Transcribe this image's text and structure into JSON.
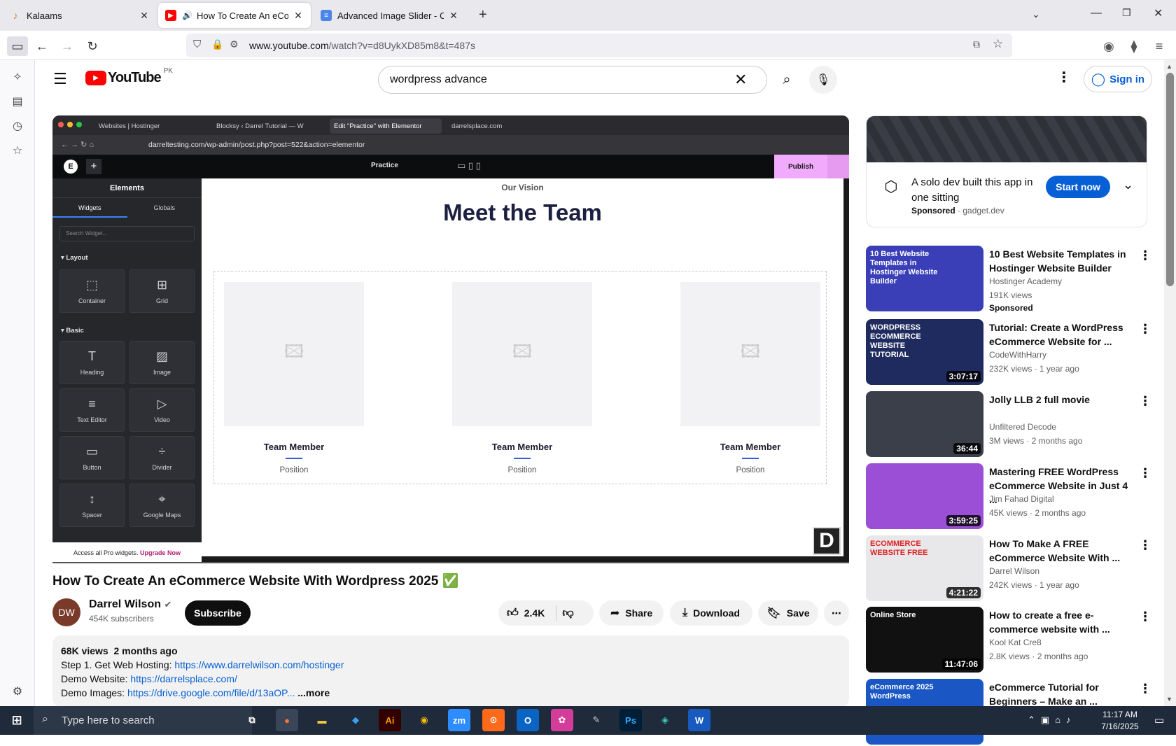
{
  "browser": {
    "tabs": [
      {
        "title": "Kalaams",
        "active": false
      },
      {
        "title": "How To Create An eComme",
        "active": true
      },
      {
        "title": "Advanced Image Slider - Code ·",
        "active": false
      }
    ],
    "new_tab": "+",
    "url_domain": "www.youtube.com",
    "url_path": "/watch?v=d8UykXD85m8&t=487s"
  },
  "youtube": {
    "logo_text": "YouTube",
    "region": "PK",
    "search_value": "wordpress advance",
    "signin_label": "Sign in"
  },
  "video_frame": {
    "inner_tabs": [
      "Websites | Hostinger",
      "Blocksy ‹ Darrel Tutorial — W",
      "Edit \"Practice\" with Elementor",
      "darrelsplace.com"
    ],
    "inner_url": "darreltesting.com/wp-admin/post.php?post=522&action=elementor",
    "page_name": "Practice",
    "publish_label": "Publish",
    "panel_title": "Elements",
    "panel_tabs": [
      "Widgets",
      "Globals"
    ],
    "search_placeholder": "Search Widget...",
    "section_layout": "Layout",
    "section_basic": "Basic",
    "widgets": [
      "Container",
      "Grid",
      "Heading",
      "Image",
      "Text Editor",
      "Video",
      "Button",
      "Divider",
      "Spacer",
      "Google Maps"
    ],
    "pro_note": "Access all Pro widgets.",
    "upgrade": "Upgrade Now",
    "vision": "Our Vision",
    "heading": "Meet the Team",
    "members": [
      {
        "name": "Team Member",
        "position": "Position"
      },
      {
        "name": "Team Member",
        "position": "Position"
      },
      {
        "name": "Team Member",
        "position": "Position"
      }
    ],
    "watermark": "D"
  },
  "video": {
    "title": "How To Create An eCommerce Website With Wordpress 2025 ✅",
    "channel": "Darrel Wilson",
    "subscribers": "454K subscribers",
    "subscribe_label": "Subscribe",
    "likes": "2.4K",
    "share_label": "Share",
    "download_label": "Download",
    "save_label": "Save",
    "views": "68K views",
    "age": "2 months ago",
    "desc_lines": [
      {
        "label": "Step 1. Get Web Hosting: ",
        "link": "https://www.darrelwilson.com/hostinger"
      },
      {
        "label": "Demo Website: ",
        "link": "https://darrelsplace.com/"
      },
      {
        "label": "Demo Images: ",
        "link": "https://drive.google.com/file/d/13aOP..."
      }
    ],
    "more_label": "...more"
  },
  "ad": {
    "title": "A solo dev built this app in one sitting",
    "sponsored": "Sponsored",
    "domain": "gadget.dev",
    "cta": "Start now"
  },
  "recommendations": [
    {
      "title": "10 Best Website Templates in Hostinger Website Builder",
      "channel": "Hostinger Academy",
      "meta": "191K views",
      "extra": "Sponsored",
      "duration": "",
      "thumb": "#3a3fb8",
      "thumb_text": "10 Best Website Templates in Hostinger Website Builder"
    },
    {
      "title": "Tutorial: Create a WordPress eCommerce Website for ...",
      "channel": "CodeWithHarry",
      "meta": "232K views · 1 year ago",
      "extra": "",
      "duration": "3:07:17",
      "thumb": "#1f2b5e",
      "thumb_text": "WORDPRESS ECOMMERCE WEBSITE TUTORIAL"
    },
    {
      "title": "Jolly LLB 2 full movie",
      "channel": "Unfiltered Decode",
      "meta": "3M views · 2 months ago",
      "extra": "",
      "duration": "36:44",
      "thumb": "#3b3f4a",
      "thumb_text": ""
    },
    {
      "title": "Mastering FREE WordPress eCommerce Website in Just 4 ...",
      "channel": "Jim Fahad Digital",
      "meta": "45K views · 2 months ago",
      "extra": "",
      "duration": "3:59:25",
      "thumb": "#9b4fd6",
      "thumb_text": ""
    },
    {
      "title": "How To Make A FREE eCommerce Website With ...",
      "channel": "Darrel Wilson",
      "meta": "242K views · 1 year ago",
      "extra": "",
      "duration": "4:21:22",
      "thumb": "#e8e8ea",
      "thumb_text": "ECOMMERCE WEBSITE FREE"
    },
    {
      "title": "How to create a free e-commerce website with ...",
      "channel": "Kool Kat Cre8",
      "meta": "2.8K views · 2 months ago",
      "extra": "",
      "duration": "11:47:06",
      "thumb": "#111111",
      "thumb_text": "Online Store"
    },
    {
      "title": "eCommerce Tutorial for Beginners – Make an ...",
      "channel": "",
      "meta": "",
      "extra": "",
      "duration": "",
      "thumb": "#1a56c4",
      "thumb_text": "eCommerce 2025 WordPress"
    }
  ],
  "taskbar": {
    "search_placeholder": "Type here to search",
    "time": "11:17 AM",
    "date": "7/16/2025"
  }
}
